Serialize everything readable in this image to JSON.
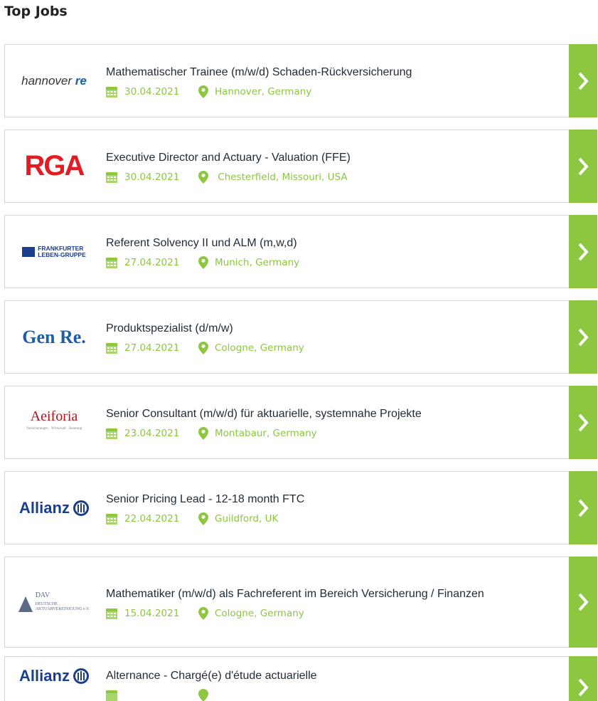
{
  "section_title": "Top Jobs",
  "colors": {
    "accent": "#8dc63f",
    "title_text": "#1f2a36",
    "border": "#d5d5d5"
  },
  "jobs": [
    {
      "company_logo": "hannover-re-logo",
      "logo_text": "hannover",
      "logo_text_b": "re",
      "title": "Mathematischer Trainee (m/w/d) Schaden-Rückversicherung",
      "date": "30.04.2021",
      "location": "Hannover, Germany"
    },
    {
      "company_logo": "rga-logo",
      "logo_text": "RGA",
      "title": "Executive Director and Actuary - Valuation (FFE)",
      "date": "30.04.2021",
      "location": " Chesterfield, Missouri, USA"
    },
    {
      "company_logo": "frankfurter-leben-logo",
      "logo_text": "FRANKFURTER",
      "logo_text_b": "LEBEN-GRUPPE",
      "title": "Referent Solvency II und ALM (m,w,d)",
      "date": "27.04.2021",
      "location": "Munich, Germany"
    },
    {
      "company_logo": "gen-re-logo",
      "logo_text": "Gen Re.",
      "title": "Produktspezialist (d/m/w)",
      "date": "27.04.2021",
      "location": "Cologne, Germany"
    },
    {
      "company_logo": "aeiforia-logo",
      "logo_text": "Aeiforia",
      "logo_sub": "Versicherungen · Wirtschaft · Beratung",
      "title": "Senior Consultant (m/w/d) für aktuarielle, systemnahe Projekte",
      "date": "23.04.2021",
      "location": "Montabaur, Germany"
    },
    {
      "company_logo": "allianz-logo",
      "logo_text": "Allianz",
      "title": "Senior Pricing Lead - 12-18 month FTC",
      "date": "22.04.2021",
      "location": "Guildford, UK"
    },
    {
      "company_logo": "dav-logo",
      "logo_text": "DAV",
      "logo_sub": "DEUTSCHE",
      "logo_sub2": "AKTUARVEREINIGUNG e.V.",
      "title": "Mathematiker (m/w/d) als Fachreferent im Bereich Versicherung / Finanzen",
      "date": "15.04.2021",
      "location": "Cologne, Germany"
    },
    {
      "company_logo": "allianz-logo",
      "logo_text": "Allianz",
      "title": "Alternance - Chargé(e) d'étude actuarielle",
      "date": "",
      "location": ""
    }
  ]
}
